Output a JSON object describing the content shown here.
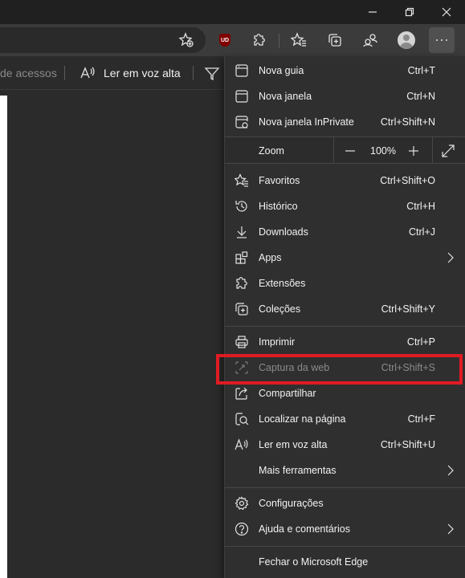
{
  "window": {
    "controls": [
      "minimize-icon",
      "restore-icon",
      "close-icon"
    ]
  },
  "toolbar": {
    "icons": [
      "add-favorite-icon",
      "ublock-icon",
      "extensions-icon",
      "favorites-icon",
      "collections-icon",
      "profile-switch-icon",
      "avatar",
      "more-icon"
    ],
    "ublock_label": "UD"
  },
  "readerbar": {
    "partial_label": "de acessos",
    "read_aloud_label": "Ler em voz alta"
  },
  "menu": {
    "items": [
      {
        "label": "Nova guia",
        "shortcut": "Ctrl+T",
        "icon": "new-tab-icon"
      },
      {
        "label": "Nova janela",
        "shortcut": "Ctrl+N",
        "icon": "new-window-icon"
      },
      {
        "label": "Nova janela InPrivate",
        "shortcut": "Ctrl+Shift+N",
        "icon": "inprivate-icon"
      }
    ],
    "zoom": {
      "label": "Zoom",
      "value": "100%"
    },
    "group2": [
      {
        "label": "Favoritos",
        "shortcut": "Ctrl+Shift+O",
        "icon": "favorites-icon"
      },
      {
        "label": "Histórico",
        "shortcut": "Ctrl+H",
        "icon": "history-icon"
      },
      {
        "label": "Downloads",
        "shortcut": "Ctrl+J",
        "icon": "download-icon"
      },
      {
        "label": "Apps",
        "shortcut": "",
        "icon": "apps-icon"
      },
      {
        "label": "Extensões",
        "shortcut": "",
        "icon": "extensions-icon"
      },
      {
        "label": "Coleções",
        "shortcut": "Ctrl+Shift+Y",
        "icon": "collections-icon"
      }
    ],
    "group3": [
      {
        "label": "Imprimir",
        "shortcut": "Ctrl+P",
        "icon": "print-icon"
      },
      {
        "label": "Captura da web",
        "shortcut": "Ctrl+Shift+S",
        "icon": "web-capture-icon"
      },
      {
        "label": "Compartilhar",
        "shortcut": "",
        "icon": "share-icon"
      },
      {
        "label": "Localizar na página",
        "shortcut": "Ctrl+F",
        "icon": "find-icon"
      },
      {
        "label": "Ler em voz alta",
        "shortcut": "Ctrl+Shift+U",
        "icon": "read-aloud-icon"
      },
      {
        "label": "Mais ferramentas",
        "shortcut": "",
        "icon": ""
      }
    ],
    "group4": [
      {
        "label": "Configurações",
        "shortcut": "",
        "icon": "settings-icon"
      },
      {
        "label": "Ajuda e comentários",
        "shortcut": "",
        "icon": "help-icon"
      }
    ],
    "close_label": "Fechar o Microsoft Edge"
  },
  "colors": {
    "highlight": "#e01b24",
    "menu_bg": "#2f2f2f",
    "toolbar_bg": "#3b3b3b"
  }
}
